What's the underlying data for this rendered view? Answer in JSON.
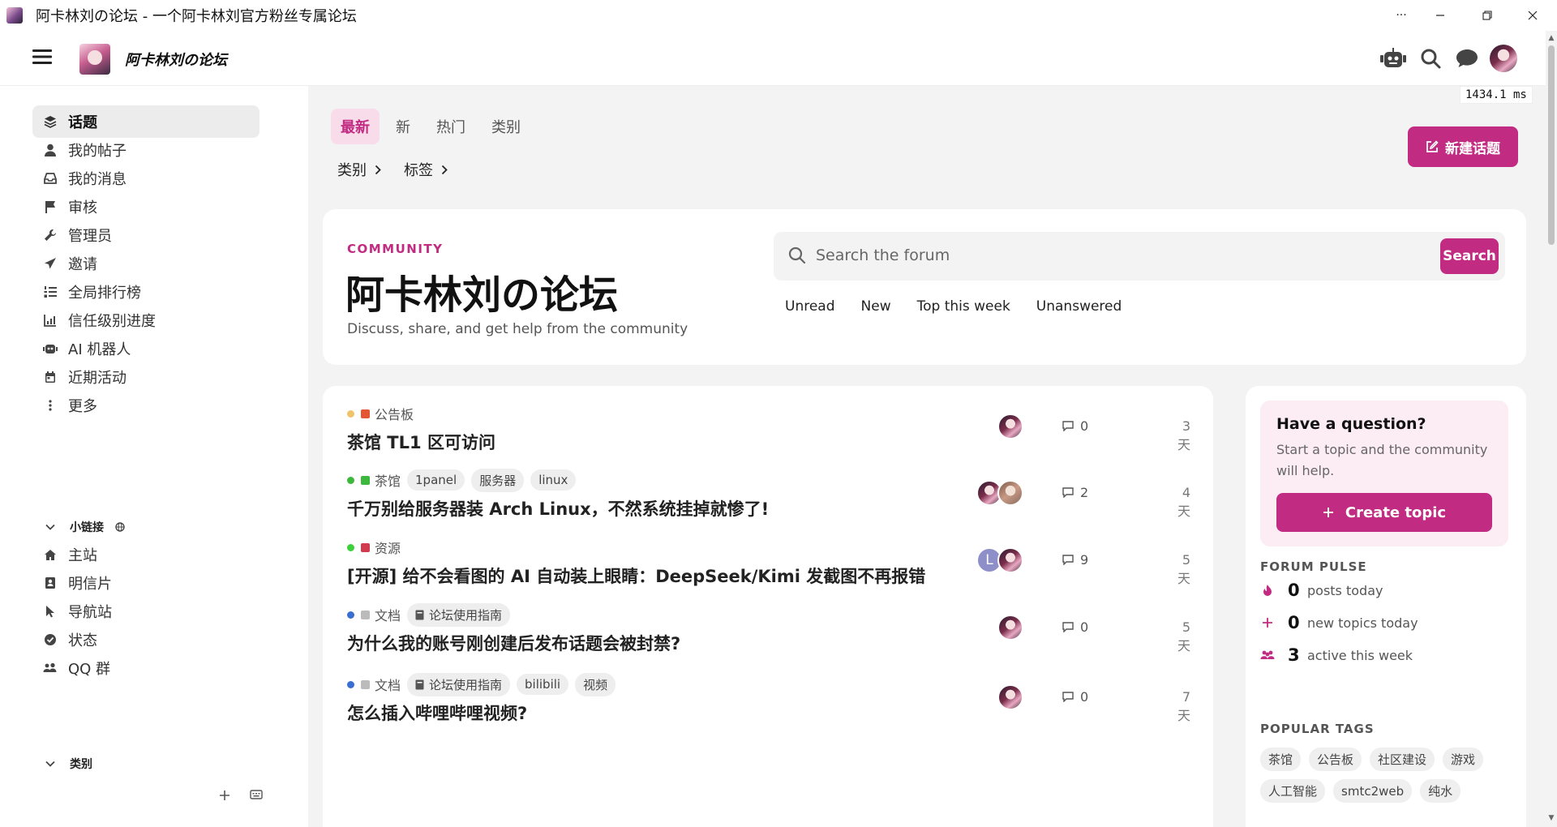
{
  "window": {
    "title": "阿卡林刘の论坛 - 一个阿卡林刘官方粉丝专属论坛",
    "more_label": "···"
  },
  "header": {
    "site_title": "阿卡林刘の论坛"
  },
  "timing": "1434.1 ms",
  "sidebar": {
    "items": [
      {
        "label": "话题",
        "icon": "layers-icon",
        "active": true
      },
      {
        "label": "我的帖子",
        "icon": "user-icon"
      },
      {
        "label": "我的消息",
        "icon": "inbox-icon"
      },
      {
        "label": "审核",
        "icon": "flag-icon"
      },
      {
        "label": "管理员",
        "icon": "wrench-icon"
      },
      {
        "label": "邀请",
        "icon": "paper-plane-icon"
      },
      {
        "label": "全局排行榜",
        "icon": "list-ol-icon"
      },
      {
        "label": "信任级别进度",
        "icon": "chart-line-icon"
      },
      {
        "label": "AI 机器人",
        "icon": "robot-icon"
      },
      {
        "label": "近期活动",
        "icon": "calendar-icon"
      },
      {
        "label": "更多",
        "icon": "ellipsis-vertical-icon"
      }
    ],
    "links_section": {
      "label": "小链接"
    },
    "links": [
      {
        "label": "主站",
        "icon": "house-icon"
      },
      {
        "label": "明信片",
        "icon": "address-card-icon"
      },
      {
        "label": "导航站",
        "icon": "pointer-icon"
      },
      {
        "label": "状态",
        "icon": "circle-check-icon"
      },
      {
        "label": "QQ 群",
        "icon": "users-icon"
      }
    ],
    "categories_section": {
      "label": "类别"
    }
  },
  "nav": {
    "tabs": [
      {
        "label": "最新",
        "active": true
      },
      {
        "label": "新"
      },
      {
        "label": "热门"
      },
      {
        "label": "类别"
      }
    ],
    "filters": [
      {
        "label": "类别"
      },
      {
        "label": "标签"
      }
    ],
    "new_topic_label": "新建话题"
  },
  "hero": {
    "kicker": "COMMUNITY",
    "title": "阿卡林刘の论坛",
    "subtitle": "Discuss, share, and get help from the community",
    "search": {
      "placeholder": "Search the forum",
      "button": "Search"
    },
    "quick_links": [
      "Unread",
      "New",
      "Top this week",
      "Unanswered"
    ]
  },
  "topics": [
    {
      "dot": "#f0c36b",
      "category": "公告板",
      "category_color": "#e45735",
      "tags": [],
      "title": "茶馆 TL1 区可访问",
      "posters": [
        "img"
      ],
      "replies": "0",
      "age": "3 天"
    },
    {
      "dot": "#3cb93c",
      "category": "茶馆",
      "category_color": "#3cb93c",
      "tags": [
        {
          "label": "1panel"
        },
        {
          "label": "服务器"
        },
        {
          "label": "linux"
        }
      ],
      "title": "千万别给服务器装 Arch Linux，不然系统挂掉就惨了!",
      "posters": [
        "img",
        "img2"
      ],
      "replies": "2",
      "age": "4 天"
    },
    {
      "dot": "#3cd13c",
      "category": "资源",
      "category_color": "#d13a4f",
      "tags": [],
      "title": "[开源] 给不会看图的 AI 自动装上眼睛：DeepSeek/Kimi 发截图不再报错",
      "posters": [
        "L",
        "img"
      ],
      "replies": "9",
      "age": "5 天"
    },
    {
      "dot": "#3a6fd1",
      "category": "文档",
      "category_color": "#bbbbbb",
      "tags": [
        {
          "label": "论坛使用指南",
          "icon": true
        }
      ],
      "title": "为什么我的账号刚创建后发布话题会被封禁?",
      "posters": [
        "img"
      ],
      "replies": "0",
      "age": "5 天"
    },
    {
      "dot": "#3a6fd1",
      "category": "文档",
      "category_color": "#bbbbbb",
      "tags": [
        {
          "label": "论坛使用指南",
          "icon": true
        },
        {
          "label": "bilibili"
        },
        {
          "label": "视频"
        }
      ],
      "title": "怎么插入哔哩哔哩视频?",
      "posters": [
        "img"
      ],
      "replies": "0",
      "age": "7 天"
    }
  ],
  "aside": {
    "ask": {
      "title": "Have a question?",
      "desc": "Start a topic and the community will help.",
      "button": "Create topic"
    },
    "pulse_heading": "FORUM PULSE",
    "pulse": [
      {
        "value": "0",
        "label": "posts today",
        "icon": "fire-icon"
      },
      {
        "value": "0",
        "label": "new topics today",
        "icon": "plus-icon"
      },
      {
        "value": "3",
        "label": "active this week",
        "icon": "users-icon"
      }
    ],
    "tags_heading": "POPULAR TAGS",
    "popular_tags": [
      "茶馆",
      "公告板",
      "社区建设",
      "游戏",
      "人工智能",
      "smtc2web",
      "纯水"
    ]
  },
  "colors": {
    "accent": "#c12c82",
    "accent_soft": "#f9dce9"
  }
}
